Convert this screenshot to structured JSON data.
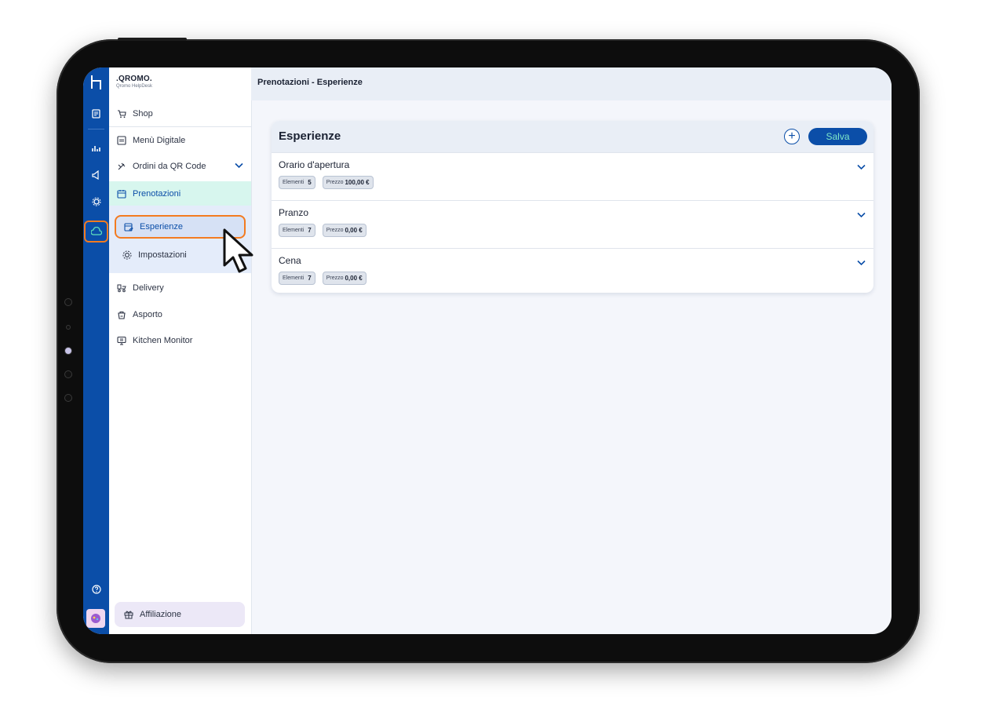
{
  "rail": {
    "icons": [
      "logo-icon",
      "document-icon",
      "bar-chart-icon",
      "megaphone-icon",
      "settings-icon",
      "cloud-sync-icon",
      "help-icon",
      "avatar"
    ],
    "accent": "#0b4ea8",
    "highlight": "#f37b20"
  },
  "brand": {
    "name": ".QROMO.",
    "subtitle": "Qromo HelpDesk"
  },
  "sidebar": {
    "items": [
      {
        "label": "Shop",
        "icon": "cart-icon"
      },
      {
        "label": "Menù Digitale",
        "icon": "menu-book-icon"
      },
      {
        "label": "Ordini da QR Code",
        "icon": "qr-order-icon"
      },
      {
        "label": "Prenotazioni",
        "icon": "calendar-icon"
      },
      {
        "label": "Delivery",
        "icon": "delivery-icon"
      },
      {
        "label": "Asporto",
        "icon": "takeaway-bag-icon"
      },
      {
        "label": "Kitchen Monitor",
        "icon": "monitor-icon"
      }
    ],
    "sub_items": [
      {
        "label": "Esperienze",
        "icon": "edit-calendar-icon"
      },
      {
        "label": "Impostazioni",
        "icon": "gear-icon"
      }
    ],
    "affiliation": {
      "label": "Affiliazione",
      "icon": "gift-icon"
    }
  },
  "header": {
    "title": "Prenotazioni - Esperienze"
  },
  "card": {
    "title": "Esperienze",
    "add_label": "+",
    "save_label": "Salva",
    "rows": [
      {
        "name": "Orario d'apertura",
        "elements_label": "Elementi",
        "elements_count": "5",
        "price_label": "Prezzo",
        "price_value": "100,00 €"
      },
      {
        "name": "Pranzo",
        "elements_label": "Elementi",
        "elements_count": "7",
        "price_label": "Prezzo",
        "price_value": "0,00 €"
      },
      {
        "name": "Cena",
        "elements_label": "Elementi",
        "elements_count": "7",
        "price_label": "Prezzo",
        "price_value": "0,00 €"
      }
    ]
  }
}
